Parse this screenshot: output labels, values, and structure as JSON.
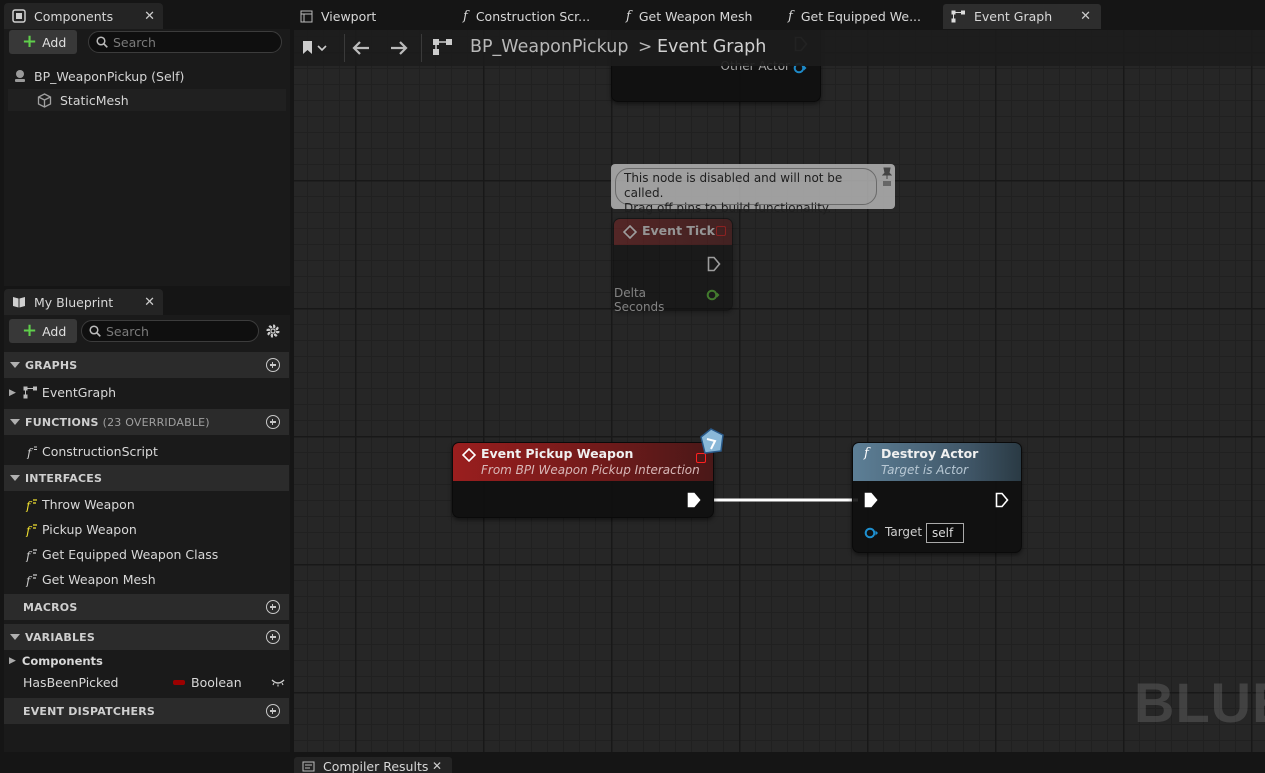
{
  "components_panel": {
    "tab_label": "Components",
    "add_label": "Add",
    "search_placeholder": "Search",
    "root_item": "BP_WeaponPickup (Self)",
    "child_item": "StaticMesh"
  },
  "my_blueprint_panel": {
    "tab_label": "My Blueprint",
    "add_label": "Add",
    "search_placeholder": "Search",
    "sections": {
      "graphs": "GRAPHS",
      "functions": "FUNCTIONS",
      "functions_sub": "(23 OVERRIDABLE)",
      "interfaces": "INTERFACES",
      "macros": "MACROS",
      "variables": "VARIABLES",
      "event_dispatchers": "EVENT DISPATCHERS"
    },
    "graph_items": [
      "EventGraph"
    ],
    "function_items": [
      "ConstructionScript"
    ],
    "interface_items": [
      "Throw Weapon",
      "Pickup Weapon",
      "Get Equipped Weapon Class",
      "Get Weapon Mesh"
    ],
    "variables_category": "Components",
    "variable": {
      "name": "HasBeenPicked",
      "type": "Boolean",
      "type_color": "#9b0000"
    }
  },
  "document_tabs": [
    "Viewport",
    "Construction Scr...",
    "Get Weapon Mesh",
    "Get Equipped We...",
    "Event Graph"
  ],
  "breadcrumb": {
    "blueprint": "BP_WeaponPickup",
    "separator": ">",
    "graph": "Event Graph"
  },
  "graph": {
    "top_node_pin": "Other Actor",
    "disabled_comment_line1": "This node is disabled and will not be called.",
    "disabled_comment_line2": "Drag off pins to build functionality.",
    "event_tick": {
      "title": "Event Tick",
      "pin": "Delta Seconds"
    },
    "event_pickup": {
      "title": "Event Pickup Weapon",
      "subtitle": "From BPI Weapon Pickup Interaction"
    },
    "destroy_actor": {
      "title": "Destroy Actor",
      "subtitle": "Target is Actor",
      "pin": "Target",
      "pin_value": "self"
    },
    "watermark": "BLUE"
  },
  "bottom_panel": {
    "tab_label": "Compiler Results"
  },
  "colors": {
    "event_header": "#8c1f1f",
    "function_header": "#4a6a7e",
    "exec_wire": "#ffffff",
    "object_pin": "#1e90d0",
    "float_pin": "#5bc236"
  }
}
